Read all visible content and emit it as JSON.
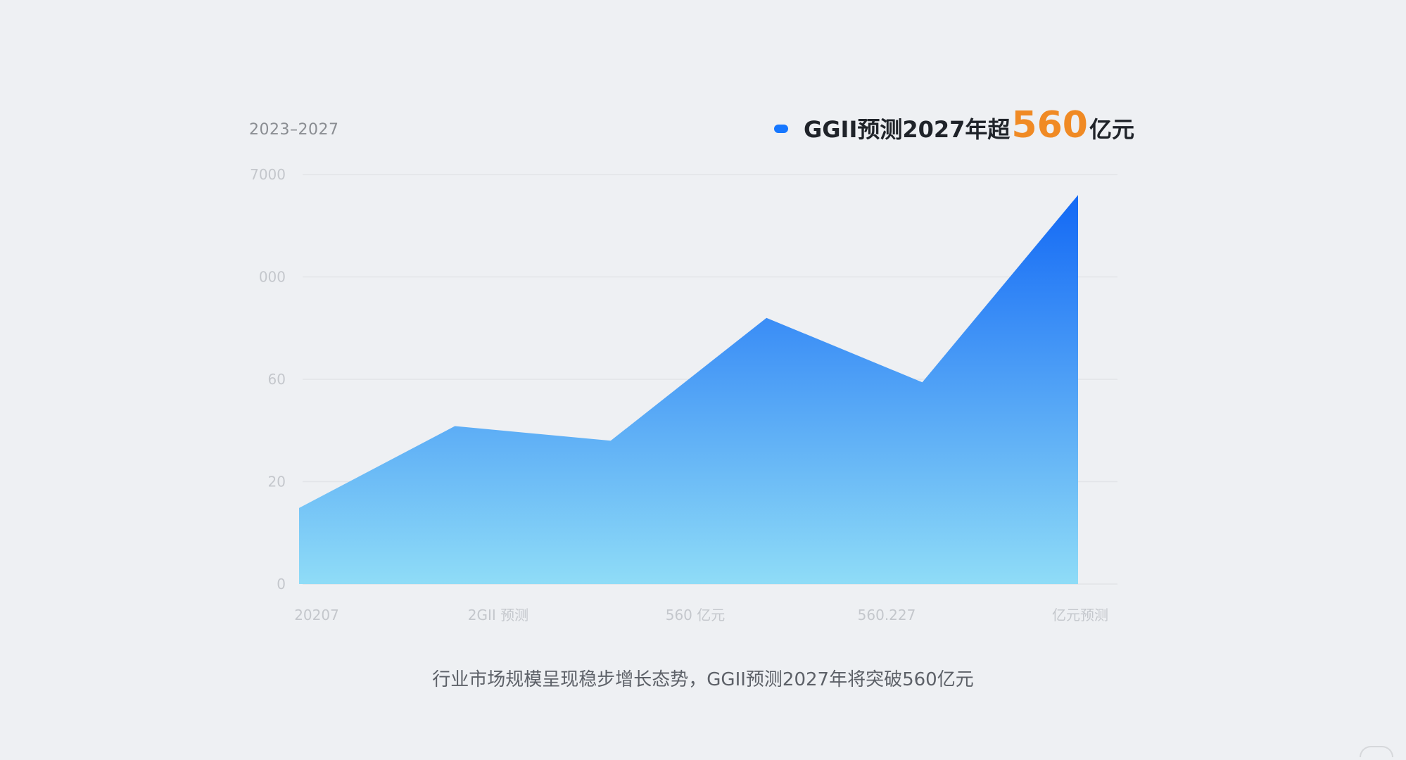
{
  "header": {
    "range_label": "2023–2027"
  },
  "legend": {
    "prefix": "GGII预测2027年超",
    "highlight": "560",
    "suffix": "亿元",
    "dot_color": "#1677ff",
    "highlight_color": "#f08a24"
  },
  "caption": "行业市场规模呈现稳步增长态势，GGII预测2027年将突破560亿元",
  "chart_data": {
    "type": "area",
    "y_tick_labels": [
      "0",
      "20",
      "60",
      "000",
      "7000"
    ],
    "x_tick_labels": [
      "20207",
      "2GII 预测",
      "560 亿元",
      "560.227",
      "亿元预测"
    ],
    "values": [
      1300,
      2700,
      2450,
      4550,
      3450,
      6650
    ],
    "ylim": [
      0,
      7000
    ],
    "grid": true,
    "legend_position": "top-right",
    "colors": {
      "gradient_top": "#1268f5",
      "gradient_bottom": "#8fdcf7",
      "grid": "#e2e4e8",
      "tick_text": "#c4c7cc"
    }
  }
}
